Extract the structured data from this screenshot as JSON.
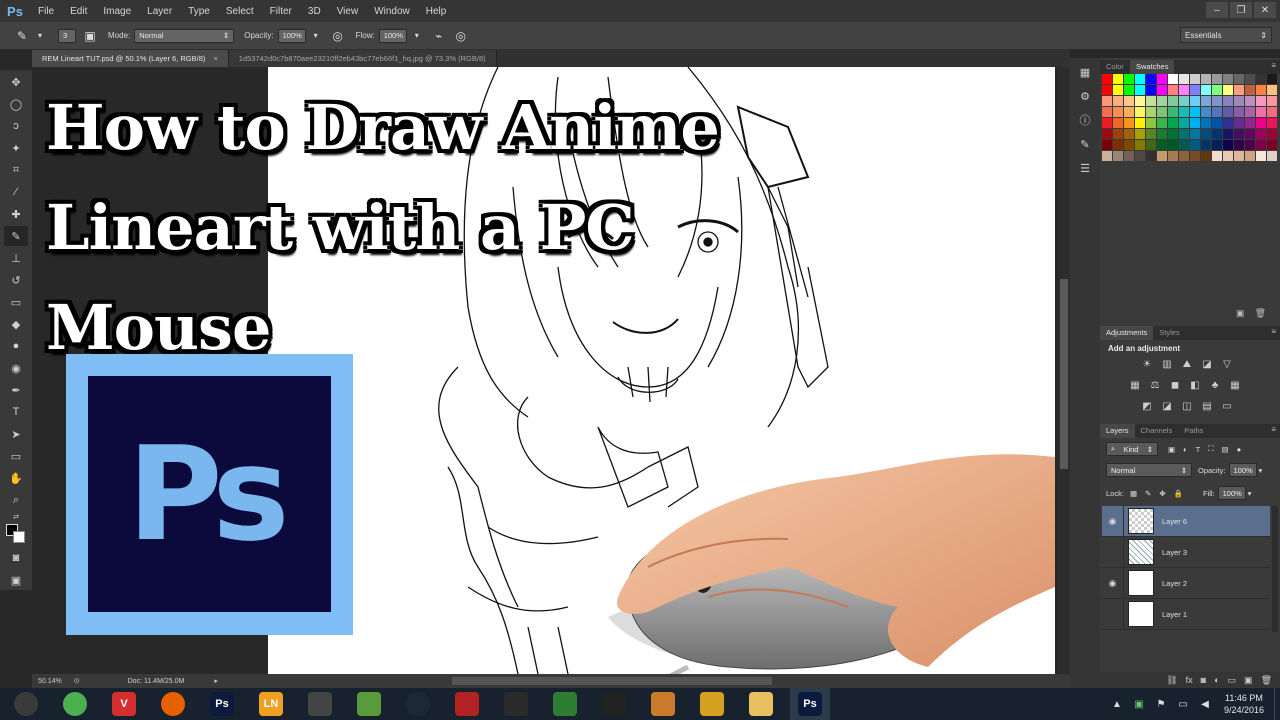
{
  "menubar": {
    "logo": "Ps",
    "items": [
      "File",
      "Edit",
      "Image",
      "Layer",
      "Type",
      "Select",
      "Filter",
      "3D",
      "View",
      "Window",
      "Help"
    ],
    "window_controls": [
      "–",
      "❐",
      "✕"
    ]
  },
  "options": {
    "brush_size": "3",
    "mode_label": "Mode:",
    "mode_value": "Normal",
    "opacity_label": "Opacity:",
    "opacity_value": "100%",
    "flow_label": "Flow:",
    "flow_value": "100%",
    "workspace": "Essentials"
  },
  "tabs": [
    {
      "label": "REM Lineart TUT.psd @ 50.1% (Layer 6, RGB/8)",
      "active": true
    },
    {
      "label": "1d53742d0c7b870aee23210ff2eb43bc77eb66f1_hq.jpg @ 73.3% (RGB/8)",
      "active": false
    }
  ],
  "overlay": {
    "title_lines": [
      "How to Draw Anime",
      "Lineart with a PC",
      "Mouse"
    ],
    "badge_text": "Ps"
  },
  "statusbar": {
    "zoom": "50.14%",
    "doc": "Doc: 11.4M/25.0M"
  },
  "panels": {
    "color_tabs": [
      "Color",
      "Swatches"
    ],
    "adjust_tabs": [
      "Adjustments",
      "Styles"
    ],
    "adjust_title": "Add an adjustment",
    "layers_tabs": [
      "Layers",
      "Channels",
      "Paths"
    ],
    "kind_label": "Kind",
    "blend_mode": "Normal",
    "opacity_label": "Opacity:",
    "opacity_value": "100%",
    "lock_label": "Lock:",
    "fill_label": "Fill:",
    "fill_value": "100%"
  },
  "layers": [
    {
      "name": "Layer 6",
      "visible": true,
      "selected": true,
      "thumb": "checker"
    },
    {
      "name": "Layer 3",
      "visible": false,
      "selected": false,
      "thumb": "sketch"
    },
    {
      "name": "Layer 2",
      "visible": true,
      "selected": false,
      "thumb": "white"
    },
    {
      "name": "Layer 1",
      "visible": false,
      "selected": false,
      "thumb": "white"
    }
  ],
  "taskbar": {
    "apps": [
      {
        "name": "start-orb",
        "label": "",
        "color": "#3a3a3a"
      },
      {
        "name": "chrome",
        "label": "",
        "color": "#4caf50"
      },
      {
        "name": "vivaldi",
        "label": "V",
        "color": "#d32f2f"
      },
      {
        "name": "firefox",
        "label": "",
        "color": "#e66000"
      },
      {
        "name": "photoshop-a",
        "label": "Ps",
        "color": "#0c1a3d"
      },
      {
        "name": "lightnovel",
        "label": "LN",
        "color": "#f0a020"
      },
      {
        "name": "unity",
        "label": "",
        "color": "#444"
      },
      {
        "name": "game",
        "label": "",
        "color": "#5a9a3a"
      },
      {
        "name": "steam",
        "label": "",
        "color": "#1b2838"
      },
      {
        "name": "filezilla",
        "label": "",
        "color": "#b22222"
      },
      {
        "name": "video-editor",
        "label": "",
        "color": "#2a2a2a"
      },
      {
        "name": "camtasia",
        "label": "",
        "color": "#2e7d32"
      },
      {
        "name": "obs",
        "label": "",
        "color": "#222"
      },
      {
        "name": "paint",
        "label": "",
        "color": "#c97a2a"
      },
      {
        "name": "tool",
        "label": "",
        "color": "#d4a020"
      },
      {
        "name": "explorer",
        "label": "",
        "color": "#e8c060"
      },
      {
        "name": "photoshop-b",
        "label": "Ps",
        "color": "#0c1a3d"
      }
    ],
    "clock_time": "11:46 PM",
    "clock_date": "9/24/2016"
  },
  "colors": {
    "accent": "#80bdf7",
    "badge_bg": "#0c0a3d",
    "selected_layer": "#5a6e8e"
  }
}
